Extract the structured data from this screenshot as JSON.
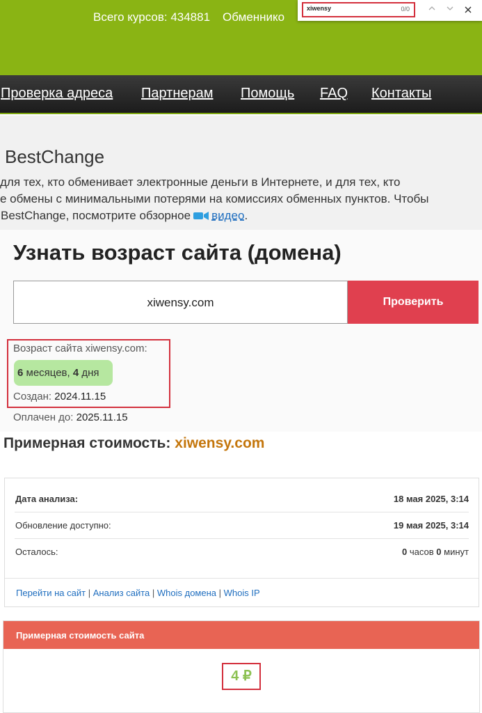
{
  "topbar": {
    "courses": "Всего курсов: 434881",
    "exchangers": "Обменнико"
  },
  "findbar": {
    "query": "xiwensy",
    "count": "0/0",
    "up_icon": "chevron-up-icon",
    "down_icon": "chevron-down-icon",
    "close_icon": "close-icon"
  },
  "nav": {
    "items": [
      {
        "label": "Проверка адреса"
      },
      {
        "label": "Партнерам"
      },
      {
        "label": "Помощь"
      },
      {
        "label": "FAQ"
      },
      {
        "label": "Контакты"
      }
    ]
  },
  "intro": {
    "title": "BestChange",
    "line1": "для тех, кто обменивает электронные деньги в Интернете, и для тех, кто",
    "line2": "е обмены с минимальными потерями на комиссиях обменных пунктов. Чтобы",
    "line3_prefix": "BestChange, посмотрите обзорное",
    "video_link": "видео",
    "line3_suffix": ".",
    "video_icon": "video-camera-icon",
    "video_icon_color": "#2f9fe0"
  },
  "age_widget": {
    "title": "Узнать возраст сайта (домена)",
    "domain_value": "xiwensy.com",
    "check_button": "Проверить",
    "age_label": "Возраст сайта xiwensy.com:",
    "age_months_num": "6",
    "age_months_word": "месяцев,",
    "age_days_num": "4",
    "age_days_word": "дня",
    "created_label": "Создан:",
    "created_value": "2024.11.15",
    "paid_label": "Оплачен до:",
    "paid_value": "2025.11.15"
  },
  "estimate": {
    "heading": "Примерная стоимость:",
    "domain": "xiwensy.com",
    "rows": [
      {
        "label": "Дата анализа:",
        "value": "18 мая 2025, 3:14"
      },
      {
        "label": "Обновление доступно:",
        "value": "19 мая 2025, 3:14"
      }
    ],
    "remaining_label": "Осталось:",
    "remaining_hours": "0",
    "remaining_hours_unit": "часов",
    "remaining_minutes": "0",
    "remaining_minutes_unit": "минут",
    "links": [
      "Перейти на сайт",
      "Анализ сайта",
      "Whois домена",
      "Whois IP"
    ]
  },
  "cost": {
    "header": "Примерная стоимость сайта",
    "value": "4 ₽"
  },
  "colors": {
    "brand_green": "#8ab414",
    "accent_red": "#e0404f",
    "cost_header": "#e86454",
    "cost_value": "#8cc152",
    "domain_orange": "#c4760c",
    "link_blue": "#1f6ebf"
  }
}
